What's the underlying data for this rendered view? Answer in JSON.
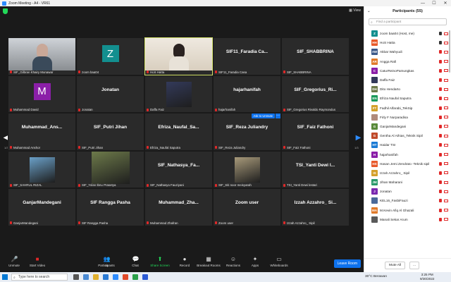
{
  "window": {
    "title": "Zoom Meeting - A4 - VR61"
  },
  "meeting": {
    "view_label": "View",
    "tiles": [
      {
        "display": "",
        "name": "SIF_Gilbran Khairy Munawar",
        "kind": "photo",
        "color": "#cfd3d8"
      },
      {
        "display": "Z",
        "name": "zoom baa04",
        "kind": "avatar",
        "color": "#138f8f"
      },
      {
        "display": "",
        "name": "HoS Hatta",
        "kind": "photo-active",
        "color": "#efe9e0"
      },
      {
        "display": "SIF11_Faradia Ca...",
        "name": "SIF11_Faradia Casa",
        "kind": "text"
      },
      {
        "display": "SIF_SHABBRINA",
        "name": "SIF_SHABBRINA",
        "kind": "text"
      },
      {
        "display": "M",
        "name": "Muhammad David",
        "kind": "avatar",
        "color": "#8b1fa8"
      },
      {
        "display": "Jonatan",
        "name": "Jonatan",
        "kind": "text"
      },
      {
        "display": "",
        "name": "Daffa Faiz",
        "kind": "mini",
        "color": "#333a5a"
      },
      {
        "display": "hajarhanifah",
        "name": "hajarhanifah",
        "kind": "text"
      },
      {
        "display": "SIF_Gregorius_Ri...",
        "name": "SIF_Gregorius Rivaldo Raymondus",
        "kind": "text"
      },
      {
        "display": "Muhammad_Ans...",
        "name": "Muhammad Anshor",
        "kind": "text"
      },
      {
        "display": "SIF_Putri Jihan",
        "name": "SIF_Putri Jihan",
        "kind": "text"
      },
      {
        "display": "Efriza_Naufal_Sa...",
        "name": "Efriza_Naufal Saputra",
        "kind": "text"
      },
      {
        "display": "SIF_Reza Juliandry",
        "name": "SIF_Reza Juliandry",
        "kind": "text-ask"
      },
      {
        "display": "SIF_Faiz Fathoni",
        "name": "SIF_Faiz Fathoni",
        "kind": "text"
      },
      {
        "display": "",
        "name": "SIF_SAHRUL RIZAL",
        "kind": "mini",
        "color": "#6aa0c8"
      },
      {
        "display": "",
        "name": "SIF_Yolan Ibnu Prasetya",
        "kind": "mini-wide",
        "color": "#6d7a4a"
      },
      {
        "display": "SIF_Nathasya_Fa...",
        "name": "SIF_Nathasya Fauziyani",
        "kind": "text"
      },
      {
        "display": "",
        "name": "SIF_Siti noor meisyarah",
        "kind": "mini",
        "color": "#a89a7a"
      },
      {
        "display": "TSI_Yanti Dewi l...",
        "name": "TSI_Yanti Dewi lestari",
        "kind": "text"
      },
      {
        "display": "GanjarMandegani",
        "name": "GanjarMandegani",
        "kind": "text"
      },
      {
        "display": "SIF Rangga Pasha",
        "name": "SIF Rangga Pasha",
        "kind": "text"
      },
      {
        "display": "Muhammad_Zha...",
        "name": "Muhammad Zhafran",
        "kind": "text"
      },
      {
        "display": "Zoom user",
        "name": "Zoom user",
        "kind": "text"
      },
      {
        "display": "Izzah Azzahro_ Si...",
        "name": "Izzah Azzahro_ Sipil",
        "kind": "text"
      }
    ],
    "ask_to_unmute": "Ask to Unmute",
    "page_left": "1/3",
    "page_right": "1/3"
  },
  "toolbar": {
    "unmute": "Unmute",
    "start_video": "Start Video",
    "participants": "Participants",
    "participants_count": "55",
    "chat": "Chat",
    "share_screen": "Share Screen",
    "record": "Record",
    "breakout_rooms": "Breakout Rooms",
    "reactions": "Reactions",
    "apps": "Apps",
    "whiteboards": "Whiteboards",
    "leave": "Leave Room"
  },
  "panel": {
    "title": "Participants (55)",
    "search_placeholder": "Find a participant",
    "participants": [
      {
        "initials": "Z",
        "name": "zoom baa04 (Host, me)",
        "color": "#138f8f",
        "mic": "#333"
      },
      {
        "initials": "HH",
        "name": "HoS Hatta",
        "color": "#e8592a",
        "mic": "#333"
      },
      {
        "initials": "AW",
        "name": "Akbar Wahyudi",
        "color": "#3d5a8a",
        "mic": "#e02828"
      },
      {
        "initials": "AR",
        "name": "Angga Rafi",
        "color": "#e07a2a",
        "mic": "#e02828"
      },
      {
        "initials": "C",
        "name": "CaturReinoPamungkas",
        "color": "#8b1fa8",
        "mic": "#e02828"
      },
      {
        "initials": "",
        "name": "Daffa Faiz",
        "color": "#333a5a",
        "mic": "#e02828"
      },
      {
        "initials": "DH",
        "name": "Dito Hendarto",
        "color": "#6d7a4a",
        "mic": "#e02828"
      },
      {
        "initials": "EN",
        "name": "Efriza Naufal Saputra",
        "color": "#1a9a5a",
        "mic": "#e02828"
      },
      {
        "initials": "FT",
        "name": "Fadhil Alfarabi_TekSip",
        "color": "#d4a02a",
        "mic": "#e02828"
      },
      {
        "initials": "",
        "name": "Firly F Nurparadisa",
        "color": "#b08a7a",
        "mic": "#e02828"
      },
      {
        "initials": "G",
        "name": "GanjarMandegani",
        "color": "#5a8a3a",
        "mic": "#e02828"
      },
      {
        "initials": "G",
        "name": "Gentha Al Athias_Teknik Sipil",
        "color": "#c04a2a",
        "mic": "#e02828"
      },
      {
        "initials": "HT",
        "name": "Haidar TSI",
        "color": "#1a7ad4",
        "mic": "#e02828"
      },
      {
        "initials": "H",
        "name": "hajarhanifah",
        "color": "#8b1fa8",
        "mic": "#e02828"
      },
      {
        "initials": "HS",
        "name": "Hasan Jemi Zendrato -Teknik sipil",
        "color": "#e8592a",
        "mic": "#e02828"
      },
      {
        "initials": "IS",
        "name": "Izzah Azzahro_ Sipil",
        "color": "#d4a02a",
        "mic": "#e02828"
      },
      {
        "initials": "JM",
        "name": "Jihan Maharani",
        "color": "#2a9a6a",
        "mic": "#e02828"
      },
      {
        "initials": "J",
        "name": "Jonatan",
        "color": "#7a2ab0",
        "mic": "#e02828"
      },
      {
        "initials": "",
        "name": "KEL16_FasbiFauzi",
        "color": "#4a6a9a",
        "mic": "#e02828"
      },
      {
        "initials": "MA",
        "name": "M.Kevin Afiq Al Ghazali",
        "color": "#e07a2a",
        "mic": "#e02828"
      },
      {
        "initials": "",
        "name": "Manali Sekar Arum",
        "color": "#5a5a5a",
        "mic": "#e02828"
      }
    ],
    "mute_all": "Mute All",
    "more": "..."
  },
  "taskbar": {
    "search_placeholder": "Type here to search",
    "weather": "30°C  Berawan",
    "time": "3:25 PM",
    "date": "9/30/2022"
  }
}
